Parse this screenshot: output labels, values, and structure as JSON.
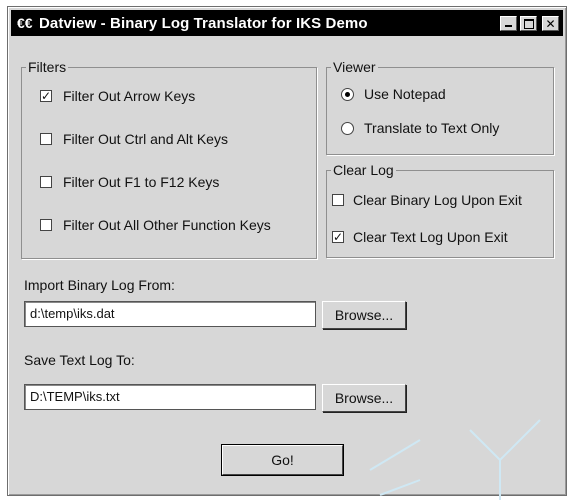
{
  "window": {
    "title": "Datview - Binary Log Translator for IKS Demo",
    "app_icon": "€€",
    "close_glyph": "✕"
  },
  "filters": {
    "title": "Filters",
    "items": [
      {
        "label": "Filter Out Arrow Keys",
        "checked": true
      },
      {
        "label": "Filter Out Ctrl and Alt Keys",
        "checked": false
      },
      {
        "label": "Filter Out F1 to F12 Keys",
        "checked": false
      },
      {
        "label": "Filter Out All Other Function Keys",
        "checked": false
      }
    ]
  },
  "viewer": {
    "title": "Viewer",
    "options": [
      {
        "label": "Use Notepad",
        "selected": true
      },
      {
        "label": "Translate to Text Only",
        "selected": false
      }
    ]
  },
  "clear_log": {
    "title": "Clear Log",
    "items": [
      {
        "label": "Clear Binary Log Upon Exit",
        "checked": false
      },
      {
        "label": "Clear Text Log Upon Exit",
        "checked": true
      }
    ]
  },
  "import": {
    "label": "Import Binary Log From:",
    "value": "d:\\temp\\iks.dat",
    "browse_label": "Browse..."
  },
  "save": {
    "label": "Save Text Log To:",
    "value": "D:\\TEMP\\iks.txt",
    "browse_label": "Browse..."
  },
  "go_label": "Go!",
  "check_glyph": "✓"
}
